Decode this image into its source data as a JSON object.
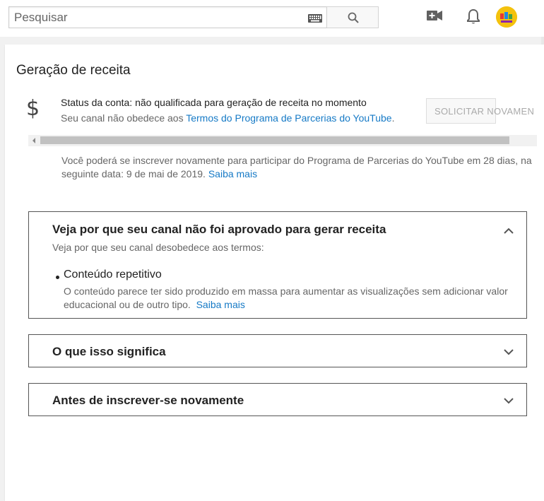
{
  "header": {
    "search_placeholder": "Pesquisar",
    "icons": [
      "keyboard-icon",
      "search-icon",
      "create-video-icon",
      "bell-icon",
      "avatar"
    ]
  },
  "page": {
    "title": "Geração de receita",
    "status_text": "Status da conta: não qualificada para geração de receita no momento",
    "sub_prefix": "Seu canal não obedece aos ",
    "sub_link": "Termos do Programa de Parcerias do YouTube",
    "sub_suffix": ".",
    "reapply_button": "SOLICITAR NOVAMEN",
    "reapply_note_line1": "Você poderá se inscrever novamente para participar do Programa de Parcerias do YouTube em 28 dias, na",
    "reapply_note_line2": "seguinte data: 9 de mai de 2019. ",
    "reapply_note_link": "Saiba mais"
  },
  "panels": {
    "why": {
      "title": "Veja por que seu canal não foi aprovado para gerar receita",
      "description": "Veja por que seu canal desobedece aos termos:",
      "reason_title": "Conteúdo repetitivo",
      "reason_desc": "O conteúdo parece ter sido produzido em massa para aumentar as visualizações sem adicionar valor educacional ou de outro tipo.",
      "reason_link": "Saiba mais"
    },
    "meaning": {
      "title": "O que isso significa"
    },
    "before": {
      "title": "Antes de inscrever-se novamente"
    }
  },
  "colors": {
    "link": "#167ac6",
    "muted_text": "#666666",
    "border": "#555555"
  }
}
